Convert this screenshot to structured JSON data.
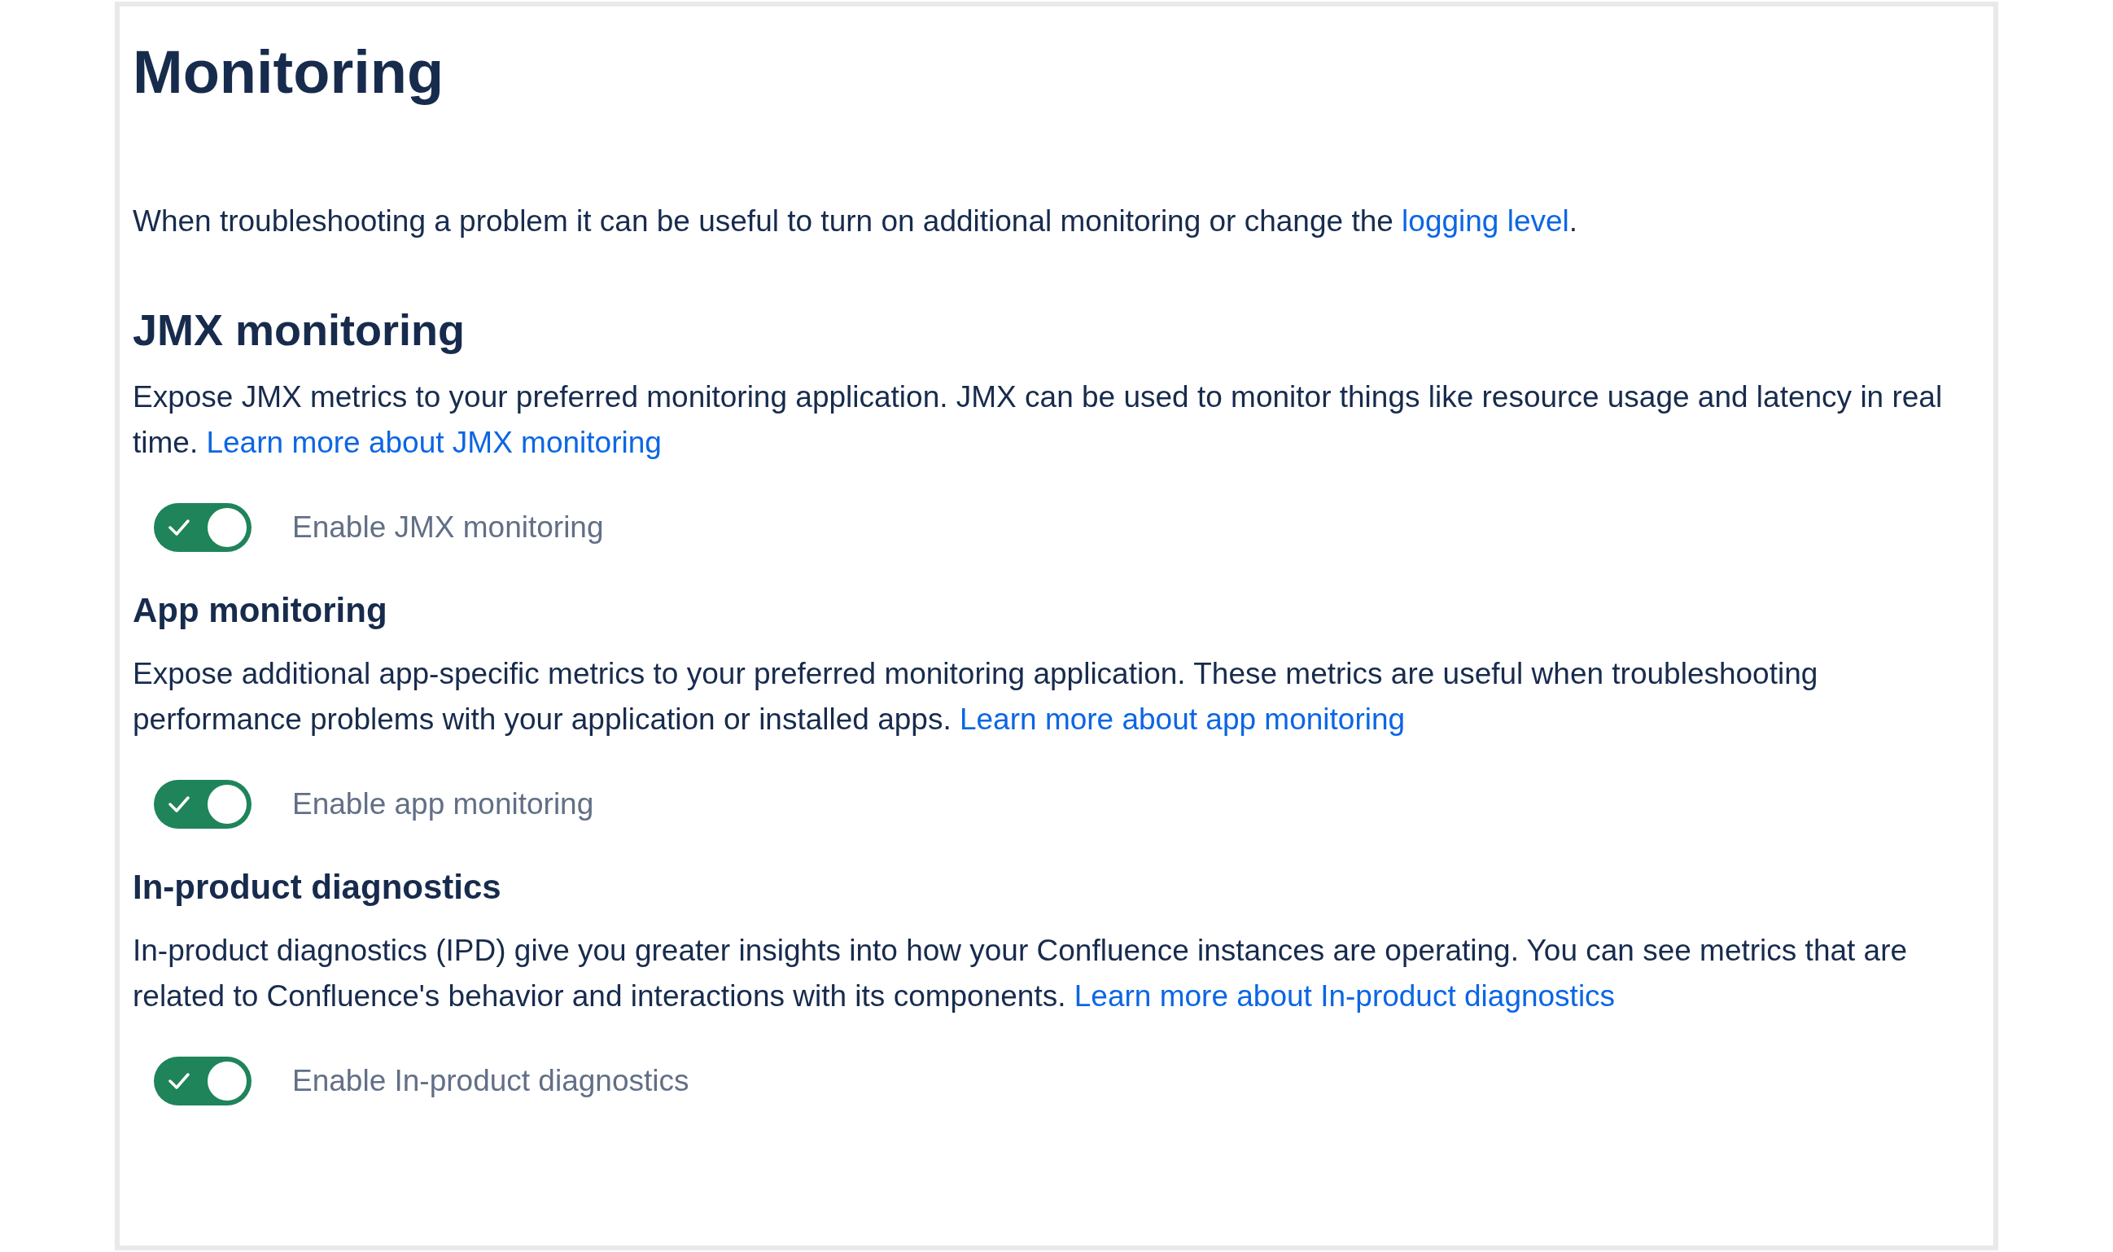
{
  "title": "Monitoring",
  "intro": {
    "text": "When troubleshooting a problem it can be useful to turn on additional monitoring or change the ",
    "link": "logging level",
    "after": "."
  },
  "sections": [
    {
      "kind": "major",
      "heading": "JMX monitoring",
      "description": "Expose JMX metrics to your preferred monitoring application. JMX can be used to monitor things like resource usage and latency in real time. ",
      "link": "Learn more about JMX monitoring",
      "toggle": {
        "label": "Enable JMX monitoring",
        "on": true
      }
    },
    {
      "kind": "minor",
      "heading": "App monitoring",
      "description": "Expose additional app-specific metrics to your preferred monitoring application. These metrics are useful when troubleshooting performance problems with your application or installed apps. ",
      "link": "Learn more about app monitoring",
      "toggle": {
        "label": "Enable app monitoring",
        "on": true
      }
    },
    {
      "kind": "minor",
      "heading": "In-product diagnostics",
      "description": "In-product diagnostics (IPD) give you greater insights into how your Confluence instances are operating. You can see metrics that are related to Confluence's behavior and interactions with its components. ",
      "link": "Learn more about In-product diagnostics",
      "toggle": {
        "label": "Enable In-product diagnostics",
        "on": true
      }
    }
  ]
}
